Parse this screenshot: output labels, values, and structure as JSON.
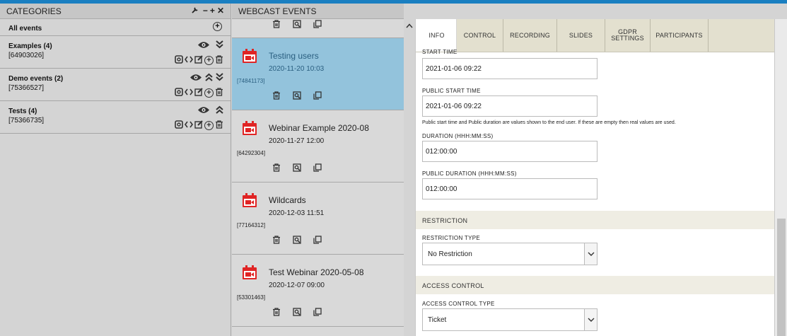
{
  "categories_panel": {
    "title": "CATEGORIES",
    "header_icons": "- + ✕",
    "all_events_label": "All events",
    "items": [
      {
        "name": "Examples (4)",
        "id": "[64903026]"
      },
      {
        "name": "Demo events (2)",
        "id": "[75366527]"
      },
      {
        "name": "Tests (4)",
        "id": "[75366735]"
      }
    ]
  },
  "events_panel": {
    "title": "WEBCAST EVENTS",
    "events": [
      {
        "title": "Testing users",
        "date": "2020-11-20 10:03",
        "id": "[74841173]",
        "selected": true
      },
      {
        "title": "Webinar Example 2020-08",
        "date": "2020-11-27 12:00",
        "id": "[64292304]"
      },
      {
        "title": "Wildcards",
        "date": "2020-12-03 11:51",
        "id": "[77164312]"
      },
      {
        "title": "Test Webinar 2020-05-08",
        "date": "2020-12-07 09:00",
        "id": "[53301463]"
      }
    ]
  },
  "details": {
    "collapse_glyph": "^",
    "tabs": [
      "INFO",
      "CONTROL",
      "RECORDING",
      "SLIDES",
      "GDPR SETTINGS",
      "PARTICIPANTS"
    ],
    "active_tab": "INFO",
    "start_time_label": "START TIME",
    "start_time_value": "2021-01-06 09:22",
    "public_start_time_label": "PUBLIC START TIME",
    "public_start_time_value": "2021-01-06 09:22",
    "public_note": "Public start time and Public duration are values shown to the end user. If these are empty then real values are used.",
    "duration_label": "DURATION (HHH:MM:SS)",
    "duration_value": "012:00:00",
    "public_duration_label": "PUBLIC DURATION (HHH:MM:SS)",
    "public_duration_value": "012:00:00",
    "restriction_section": "RESTRICTION",
    "restriction_type_label": "RESTRICTION TYPE",
    "restriction_type_value": "No Restriction",
    "access_section": "ACCESS CONTROL",
    "access_type_label": "ACCESS CONTROL TYPE",
    "access_type_value": "Ticket"
  },
  "colors": {
    "accent": "#1a7fc1",
    "selected_event": "#93c3dc",
    "calendar_icon": "#e02424",
    "section_bg": "#efede3"
  }
}
